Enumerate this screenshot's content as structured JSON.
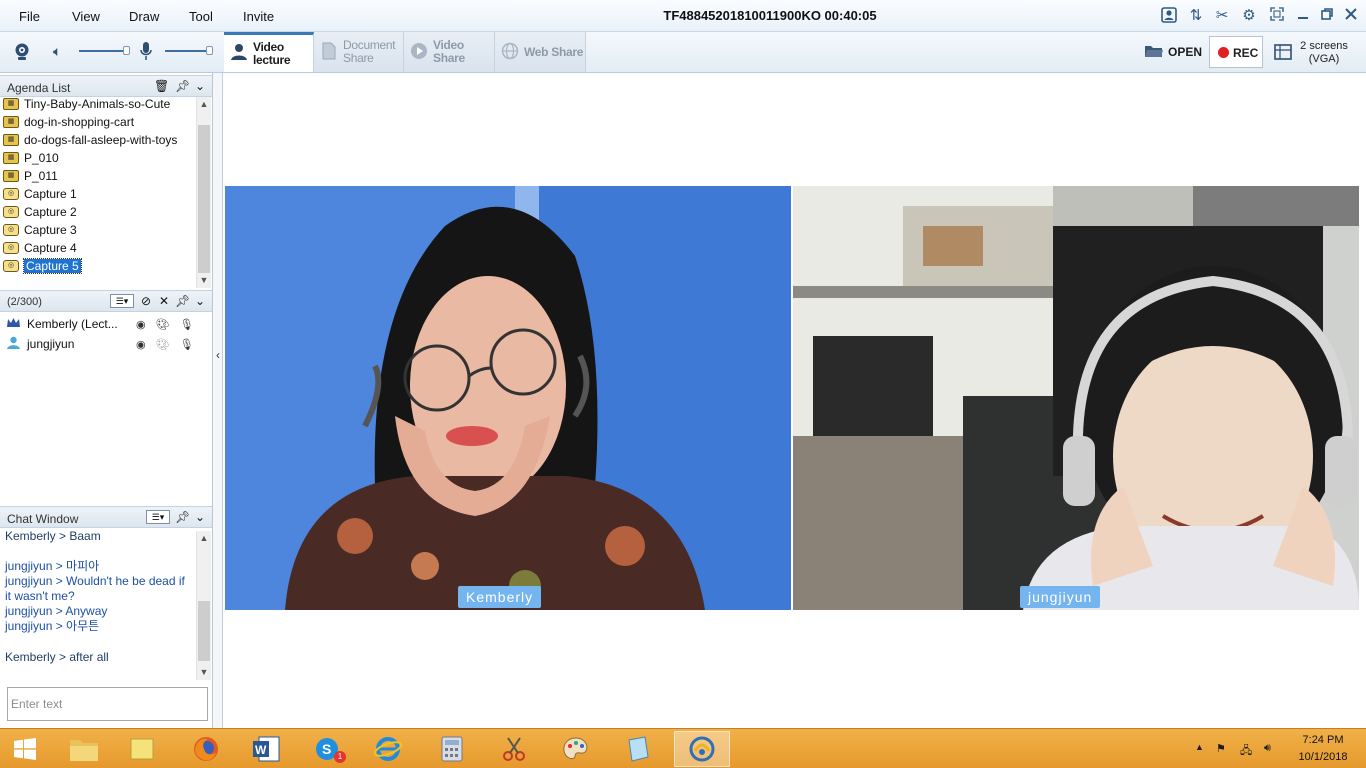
{
  "menu": {
    "items": [
      "File",
      "View",
      "Draw",
      "Tool",
      "Invite"
    ],
    "session_title": "TF4884520181001190​0KO 00:40:05"
  },
  "toolbar": {
    "tabs": [
      {
        "label_line1": "Video",
        "label_line2": "lecture",
        "active": true
      },
      {
        "label_line1": "Document",
        "label_line2": "Share",
        "active": false
      },
      {
        "label": "Video Share",
        "active": false
      },
      {
        "label": "Web Share",
        "active": false
      }
    ],
    "speaker_volume": 0.9,
    "mic_volume": 0.9,
    "open_label": "OPEN",
    "rec_label": "REC",
    "screens_line1": "2 screens",
    "screens_line2": "(VGA)"
  },
  "agenda": {
    "title": "Agenda List",
    "items": [
      {
        "label": "Tiny-Baby-Animals-so-Cute",
        "kind": "image"
      },
      {
        "label": "dog-in-shopping-cart",
        "kind": "image"
      },
      {
        "label": "do-dogs-fall-asleep-with-toys",
        "kind": "image"
      },
      {
        "label": "P_010",
        "kind": "image"
      },
      {
        "label": "P_011",
        "kind": "image"
      },
      {
        "label": "Capture 1",
        "kind": "capture"
      },
      {
        "label": "Capture 2",
        "kind": "capture"
      },
      {
        "label": "Capture 3",
        "kind": "capture"
      },
      {
        "label": "Capture 4",
        "kind": "capture"
      },
      {
        "label": "Capture 5",
        "kind": "capture",
        "selected": true
      }
    ]
  },
  "participants": {
    "count": "(2/300)",
    "users": [
      {
        "name": "Kemberly (Lect...",
        "role": "lecturer"
      },
      {
        "name": "jungjiyun",
        "role": "student"
      }
    ]
  },
  "chat": {
    "title": "Chat Window",
    "messages": [
      {
        "text": "Kemberly > Baam",
        "speaker": "k"
      },
      {
        "text": "jungjiyun > 마피아",
        "speaker": "l"
      },
      {
        "text": "jungjiyun > Wouldn't he be dead if it wasn't me?",
        "speaker": "l"
      },
      {
        "text": "jungjiyun > Anyway",
        "speaker": "l"
      },
      {
        "text": "jungjiyun > 아무튼",
        "speaker": "l"
      },
      {
        "text": "Kemberly > after all",
        "speaker": "k"
      }
    ],
    "input_placeholder": "Enter text"
  },
  "videos": [
    {
      "name": "Kemberly"
    },
    {
      "name": "jungjiyun"
    }
  ],
  "taskbar": {
    "time": "7:24 PM",
    "date": "10/1/2018",
    "skype_badge": "1"
  },
  "colors": {
    "accent": "#3b78b6",
    "name_tag": "#74b4ef",
    "rec": "#e02020",
    "taskbar": "#e99d30"
  }
}
